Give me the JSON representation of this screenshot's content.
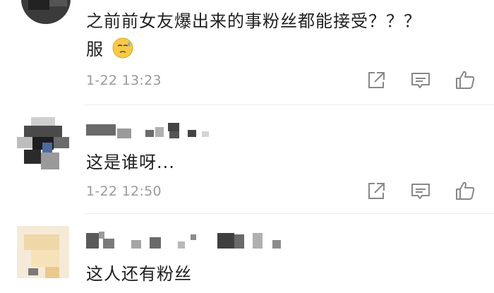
{
  "comments": [
    {
      "text": "之前前女友爆出来的事粉丝都能接受？？？服",
      "line1": "之前前女友爆出来的事粉丝都能接受？？？",
      "line2": "服",
      "emoji": "sweat-face-emoji",
      "time": "1-22 13:23"
    },
    {
      "text": "这是谁呀...",
      "time": "1-22 12:50"
    },
    {
      "text": "这人还有粉丝"
    }
  ],
  "icons": {
    "share": "share-icon",
    "comment": "comment-icon",
    "like": "like-icon"
  },
  "colors": {
    "text": "#1f1f1f",
    "meta": "#9a9a9a",
    "icon": "#888888",
    "divider": "#ececec"
  }
}
